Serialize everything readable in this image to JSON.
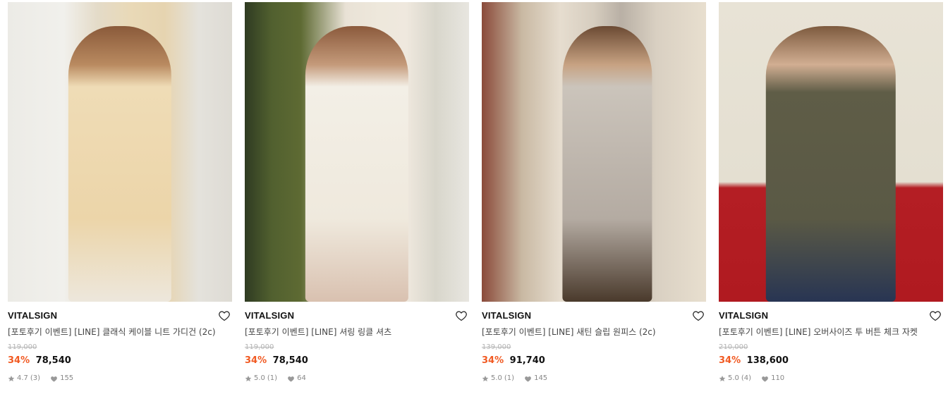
{
  "products": [
    {
      "brand": "VITALSIGN",
      "name": "[포토후기 이벤트] [LINE] 클래식 케이블 니트 가디건 (2c)",
      "original_price": "119,000",
      "discount": "34%",
      "price": "78,540",
      "rating": "4.7",
      "review_count": "(3)",
      "likes": "155"
    },
    {
      "brand": "VITALSIGN",
      "name": "[포토후기 이벤트] [LINE] 셔링 링클 셔츠",
      "original_price": "119,000",
      "discount": "34%",
      "price": "78,540",
      "rating": "5.0",
      "review_count": "(1)",
      "likes": "64"
    },
    {
      "brand": "VITALSIGN",
      "name": "[포토후기 이벤트] [LINE] 새틴 슬립 원피스 (2c)",
      "original_price": "139,000",
      "discount": "34%",
      "price": "91,740",
      "rating": "5.0",
      "review_count": "(1)",
      "likes": "145"
    },
    {
      "brand": "VITALSIGN",
      "name": "[포토후기 이벤트] [LINE] 오버사이즈 투 버튼 체크 자켓",
      "original_price": "210,000",
      "discount": "34%",
      "price": "138,600",
      "rating": "5.0",
      "review_count": "(4)",
      "likes": "110"
    }
  ],
  "icons": {
    "wishlist": "heart-outline-icon",
    "rating": "star-icon",
    "likes": "heart-filled-icon"
  },
  "colors": {
    "discount": "#f15a22",
    "original_price": "#b5b5b5",
    "stats": "#888888"
  }
}
